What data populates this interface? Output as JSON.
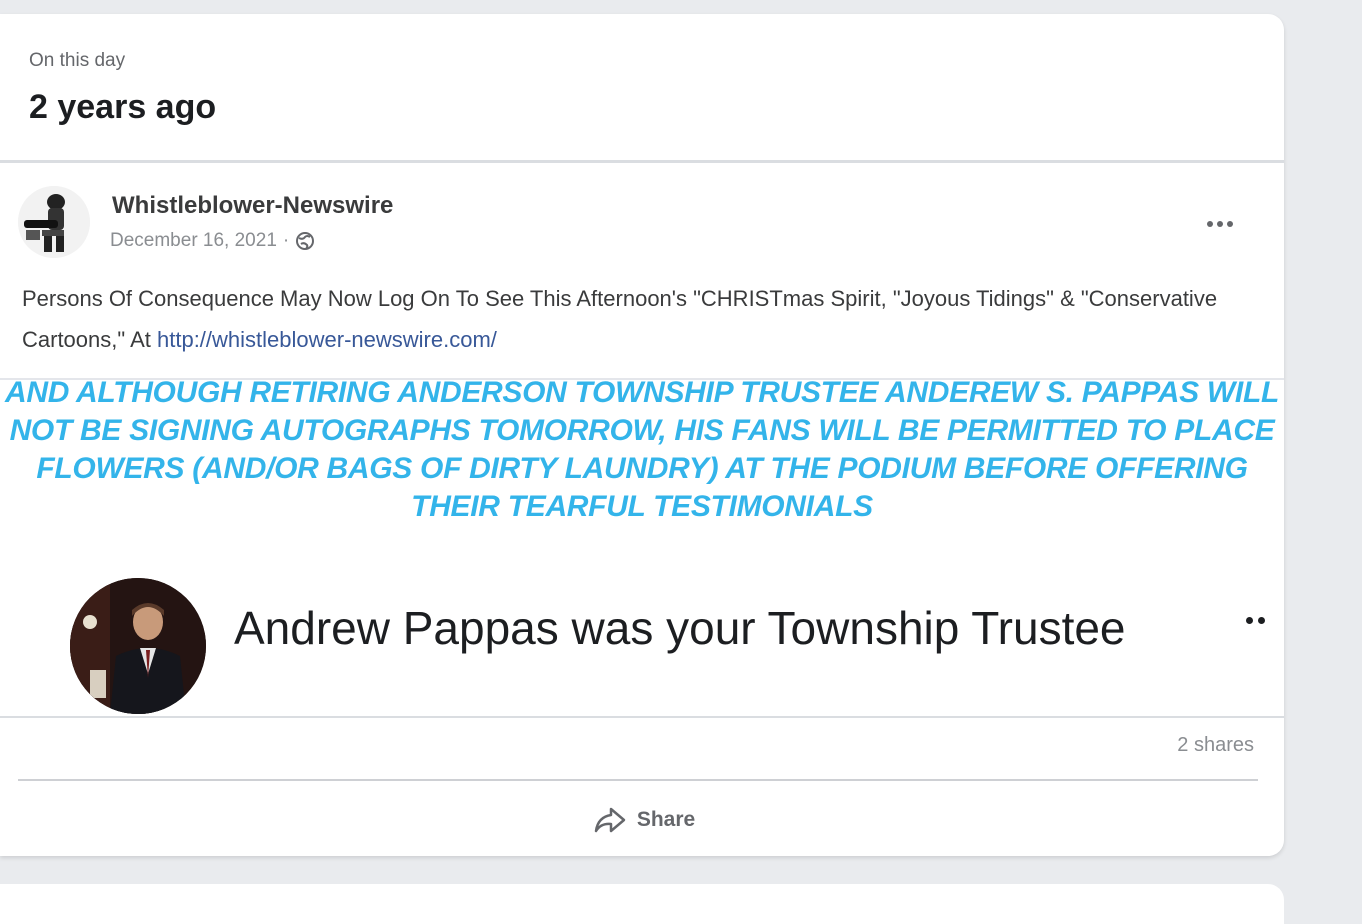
{
  "memory": {
    "eyebrow": "On this day",
    "title": "2 years ago"
  },
  "post": {
    "author": "Whistleblower-Newswire",
    "date": "December 16, 2021",
    "separator": "·",
    "privacy_icon": "globe-icon",
    "more_icon": "more-options-icon",
    "text": "Persons Of Consequence May Now Log On To See This Afternoon's \"CHRISTmas Spirit, \"Joyous Tidings\" & \"Conservative Cartoons,\" At ",
    "link": "http://whistleblower-newswire.com/",
    "headline": "AND ALTHOUGH RETIRING ANDERSON TOWNSHIP TRUSTEE ANDEREW S. PAPPAS WILL NOT BE SIGNING AUTOGRAPHS TOMORROW, HIS FANS WILL BE PERMITTED TO PLACE FLOWERS (AND/OR BAGS OF DIRTY LAUNDRY) AT THE PODIUM BEFORE OFFERING THEIR TEARFUL TESTIMONIALS",
    "headline_color": "#33b4ea"
  },
  "shared": {
    "title": "Andrew Pappas was your Township Trustee",
    "shares": "2 shares"
  },
  "actions": {
    "share_label": "Share",
    "share_icon": "share-arrow-icon"
  }
}
